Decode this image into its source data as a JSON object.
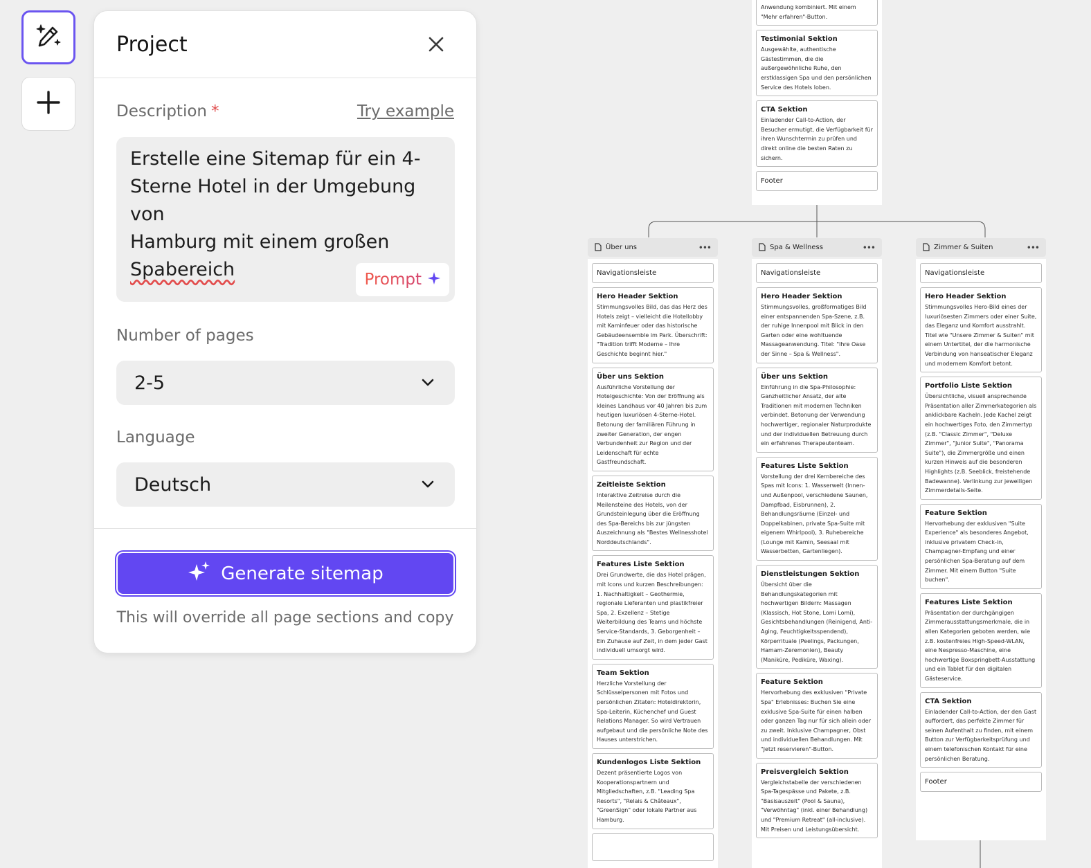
{
  "toolbar": {
    "ai_tool_icon": "magic-wand-sparkle-icon",
    "add_icon": "plus-icon"
  },
  "panel": {
    "title": "Project",
    "description_label": "Description",
    "required_mark": "*",
    "try_example": "Try example",
    "description_value": "Erstelle eine Sitemap für ein 4-\nSterne Hotel in der Umgebung von\nHamburg mit einem großen\n",
    "description_last_word": "Spabereich",
    "prompt_label": "Prompt",
    "pages_label": "Number of pages",
    "pages_value": "2-5",
    "language_label": "Language",
    "language_value": "Deutsch",
    "generate_label": "Generate sitemap",
    "override_note": "This will override all page sections and copy"
  },
  "colors": {
    "accent": "#6247f2",
    "prompt_gradient_start": "#f0594a",
    "prompt_gradient_end": "#d4446e"
  },
  "sitemap": {
    "top": {
      "sections": [
        {
          "title": "",
          "desc": "Anwendung kombiniert. Mit einem \"Mehr erfahren\"-Button."
        },
        {
          "title": "Testimonial Sektion",
          "desc": "Ausgewählte, authentische Gästestimmen, die die außergewöhnliche Ruhe, den erstklassigen Spa und den persönlichen Service des Hotels loben."
        },
        {
          "title": "CTA Sektion",
          "desc": "Einladender Call-to-Action, der Besucher ermutigt, die Verfügbarkeit für ihren Wunschtermin zu prüfen und direkt online die besten Raten zu sichern."
        },
        {
          "title": "Footer",
          "desc": ""
        }
      ]
    },
    "pages": [
      {
        "title": "Über uns",
        "sections": [
          {
            "title": "Navigationsleiste",
            "desc": ""
          },
          {
            "title": "Hero Header Sektion",
            "desc": "Stimmungsvolles Bild, das das Herz des Hotels zeigt – vielleicht die Hotellobby mit Kaminfeuer oder das historische Gebäudeensemble im Park. Überschrift: \"Tradition trifft Moderne – Ihre Geschichte beginnt hier.\""
          },
          {
            "title": "Über uns Sektion",
            "desc": "Ausführliche Vorstellung der Hotelgeschichte: Von der Eröffnung als kleines Landhaus vor 40 Jahren bis zum heutigen luxuriösen 4-Sterne-Hotel. Betonung der familiären Führung in zweiter Generation, der engen Verbundenheit zur Region und der Leidenschaft für echte Gastfreundschaft."
          },
          {
            "title": "Zeitleiste Sektion",
            "desc": "Interaktive Zeitreise durch die Meilensteine des Hotels, von der Grundsteinlegung über die Eröffnung des Spa-Bereichs bis zur jüngsten Auszeichnung als \"Bestes Wellnesshotel Norddeutschlands\"."
          },
          {
            "title": "Features Liste Sektion",
            "desc": "Drei Grundwerte, die das Hotel prägen, mit Icons und kurzen Beschreibungen: 1. Nachhaltigkeit – Geothermie, regionale Lieferanten und plastikfreier Spa, 2. Exzellenz – Stetige Weiterbildung des Teams und höchste Service-Standards, 3. Geborgenheit – Ein Zuhause auf Zeit, in dem jeder Gast individuell umsorgt wird."
          },
          {
            "title": "Team Sektion",
            "desc": "Herzliche Vorstellung der Schlüsselpersonen mit Fotos und persönlichen Zitaten: Hoteldirektorin, Spa-Leiterin, Küchenchef und Guest Relations Manager. So wird Vertrauen aufgebaut und die persönliche Note des Hauses unterstrichen."
          },
          {
            "title": "Kundenlogos Liste Sektion",
            "desc": "Dezent präsentierte Logos von Kooperationspartnern und Mitgliedschaften, z.B. \"Leading Spa Resorts\", \"Relais & Châteaux\", \"GreenSign\" oder lokale Partner aus Hamburg."
          },
          {
            "title": "",
            "desc": ""
          }
        ]
      },
      {
        "title": "Spa & Wellness",
        "sections": [
          {
            "title": "Navigationsleiste",
            "desc": ""
          },
          {
            "title": "Hero Header Sektion",
            "desc": "Stimmungsvolles, großformatiges Bild einer entspannenden Spa-Szene, z.B. der ruhige Innenpool mit Blick in den Garten oder eine wohltuende Massageanwendung. Titel: \"Ihre Oase der Sinne – Spa & Wellness\"."
          },
          {
            "title": "Über uns Sektion",
            "desc": "Einführung in die Spa-Philosophie: Ganzheitlicher Ansatz, der alte Traditionen mit modernen Techniken verbindet. Betonung der Verwendung hochwertiger, regionaler Naturprodukte und der individuellen Betreuung durch ein erfahrenes Therapeutenteam."
          },
          {
            "title": "Features Liste Sektion",
            "desc": "Vorstellung der drei Kernbereiche des Spas mit Icons: 1. Wasserwelt (Innen- und Außenpool, verschiedene Saunen, Dampfbad, Eisbrunnen), 2. Behandlungsräume (Einzel- und Doppelkabinen, private Spa-Suite mit eigenem Whirlpool), 3. Ruhebereiche (Lounge mit Kamin, Seesaal mit Wasserbetten, Gartenliegen)."
          },
          {
            "title": "Dienstleistungen Sektion",
            "desc": "Übersicht über die Behandlungskategorien mit hochwertigen Bildern: Massagen (Klassisch, Hot Stone, Lomi Lomi), Gesichtsbehandlungen (Reinigend, Anti-Aging, Feuchtigkeitsspendend), Körperrituale (Peelings, Packungen, Hamam-Zeremonien), Beauty (Maniküre, Pediküre, Waxing)."
          },
          {
            "title": "Feature Sektion",
            "desc": "Hervorhebung des exklusiven \"Private Spa\" Erlebnisses: Buchen Sie eine exklusive Spa-Suite für einen halben oder ganzen Tag nur für sich allein oder zu zweit. Inklusive Champagner, Obst und individuellen Behandlungen. Mit \"Jetzt reservieren\"-Button."
          },
          {
            "title": "Preisvergleich Sektion",
            "desc": "Vergleichstabelle der verschiedenen Spa-Tagespässe und Pakete, z.B. \"Basisauszeit\" (Pool & Sauna), \"Verwöhntag\" (inkl. einer Behandlung) und \"Premium Retreat\" (all-inclusive). Mit Preisen und Leistungsübersicht."
          }
        ]
      },
      {
        "title": "Zimmer & Suiten",
        "sections": [
          {
            "title": "Navigationsleiste",
            "desc": ""
          },
          {
            "title": "Hero Header Sektion",
            "desc": "Stimmungsvolles Hero-Bild eines der luxuriösesten Zimmers oder einer Suite, das Eleganz und Komfort ausstrahlt. Titel wie \"Unsere Zimmer & Suiten\" mit einem Untertitel, der die harmonische Verbindung von hanseatischer Eleganz und modernem Komfort betont."
          },
          {
            "title": "Portfolio Liste Sektion",
            "desc": "Übersichtliche, visuell ansprechende Präsentation aller Zimmerkategorien als anklickbare Kacheln. Jede Kachel zeigt ein hochwertiges Foto, den Zimmertyp (z.B. \"Classic Zimmer\", \"Deluxe Zimmer\", \"Junior Suite\", \"Panorama Suite\"), die Zimmergröße und einen kurzen Hinweis auf die besonderen Highlights (z.B. Seeblick, freistehende Badewanne). Verlinkung zur jeweiligen Zimmerdetails-Seite."
          },
          {
            "title": "Feature Sektion",
            "desc": "Hervorhebung der exklusiven \"Suite Experience\" als besonderes Angebot, inklusive privatem Check-in, Champagner-Empfang und einer persönlichen Spa-Beratung auf dem Zimmer. Mit einem Button \"Suite buchen\"."
          },
          {
            "title": "Features Liste Sektion",
            "desc": "Präsentation der durchgängigen Zimmerausstattungsmerkmale, die in allen Kategorien geboten werden, wie z.B. kostenfreies High-Speed-WLAN, eine Nespresso-Maschine, eine hochwertige Boxspringbett-Ausstattung und ein Tablet für den digitalen Gästeservice."
          },
          {
            "title": "CTA Sektion",
            "desc": "Einladender Call-to-Action, der den Gast auffordert, das perfekte Zimmer für seinen Aufenthalt zu finden, mit einem Button zur Verfügbarkeitsprüfung und einem telefonischen Kontakt für eine persönlichen Beratung."
          },
          {
            "title": "Footer",
            "desc": ""
          }
        ]
      }
    ]
  }
}
